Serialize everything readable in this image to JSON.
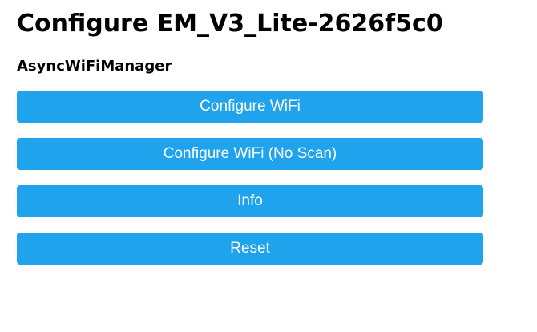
{
  "header": {
    "title": "Configure EM_V3_Lite-2626f5c0",
    "subtitle": "AsyncWiFiManager"
  },
  "menu": {
    "buttons": [
      {
        "label": "Configure WiFi"
      },
      {
        "label": "Configure WiFi (No Scan)"
      },
      {
        "label": "Info"
      },
      {
        "label": "Reset"
      }
    ]
  },
  "colors": {
    "button_background": "#1fa3ec",
    "button_text": "#ffffff",
    "page_background": "#ffffff",
    "text": "#000000"
  }
}
